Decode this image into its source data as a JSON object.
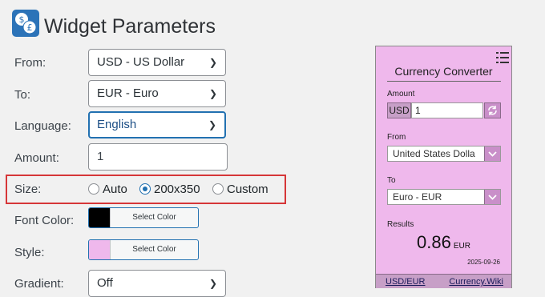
{
  "header": {
    "title": "Widget Parameters"
  },
  "form": {
    "from_label": "From:",
    "from_value": "USD - US Dollar",
    "to_label": "To:",
    "to_value": "EUR - Euro",
    "language_label": "Language:",
    "language_value": "English",
    "amount_label": "Amount:",
    "amount_value": "1",
    "size_label": "Size:",
    "size_options": [
      "Auto",
      "200x350",
      "Custom"
    ],
    "size_selected": "200x350",
    "font_color_label": "Font Color:",
    "font_color_button": "Select Color",
    "font_color": "#000000",
    "style_label": "Style:",
    "style_button": "Select Color",
    "style_color": "#efb8ec",
    "gradient_label": "Gradient:",
    "gradient_value": "Off"
  },
  "widget": {
    "title": "Currency Converter",
    "amount_label": "Amount",
    "currency_code": "USD",
    "amount_value": "1",
    "from_label": "From",
    "from_value": "United States Dolla",
    "to_label": "To",
    "to_value": "Euro - EUR",
    "results_label": "Results",
    "result_value": "0.86",
    "result_currency": "EUR",
    "date": "2025-09-26",
    "footer_link_pair": "USD/EUR",
    "footer_link_site": "Currency.Wiki"
  },
  "colors": {
    "accent": "#2271b1",
    "highlight_border": "#d63638",
    "widget_bg": "#efb8ec"
  }
}
